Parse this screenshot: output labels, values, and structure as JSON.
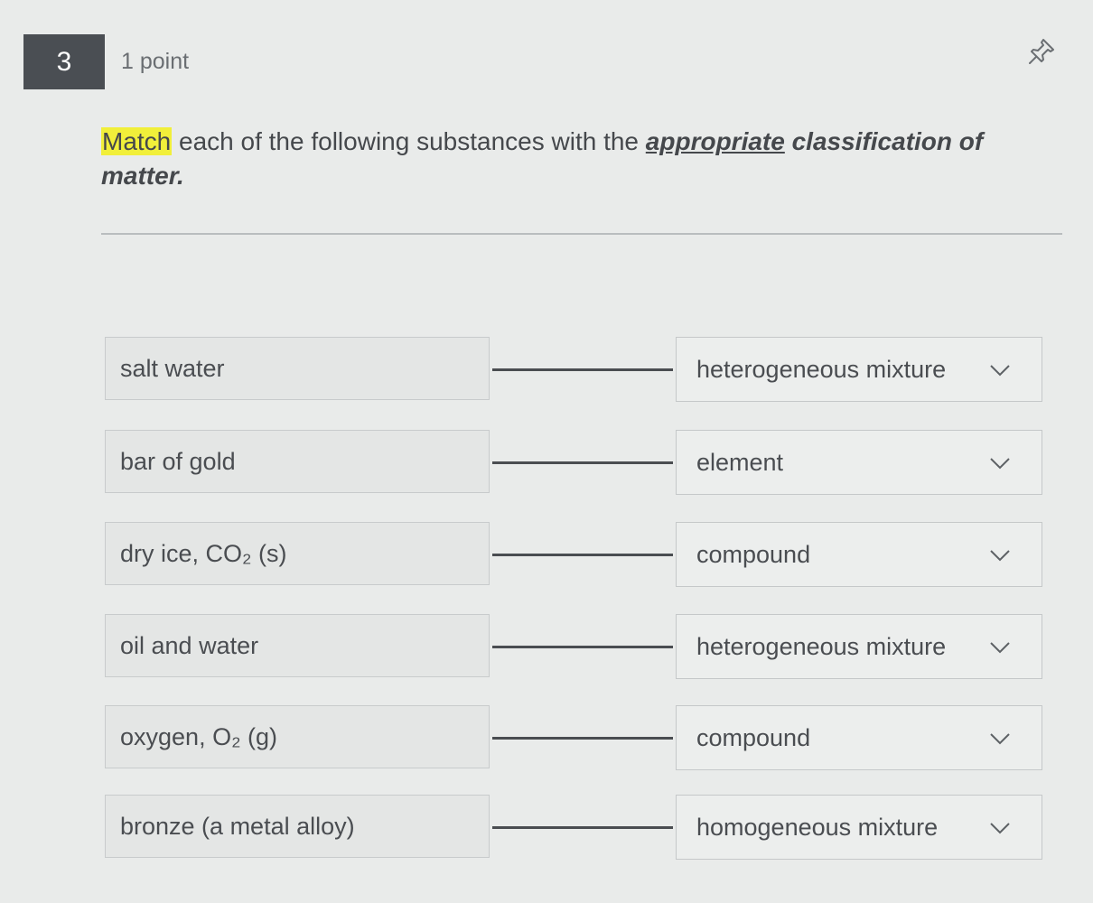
{
  "question": {
    "number": "3",
    "points": "1 point",
    "text_match": "Match",
    "text_mid": " each of the following substances with the ",
    "text_appropriate": "appropriate",
    "text_end": " classification of matter."
  },
  "pairs": [
    {
      "prompt": "salt water",
      "selected": "heterogeneous mixture"
    },
    {
      "prompt": "bar of gold",
      "selected": "element"
    },
    {
      "prompt": "dry ice, CO₂ (s)",
      "selected": "compound"
    },
    {
      "prompt": "oil and water",
      "selected": "heterogeneous mixture"
    },
    {
      "prompt": "oxygen, O₂ (g)",
      "selected": "compound"
    },
    {
      "prompt": "bronze (a metal alloy)",
      "selected": "homogeneous mixture"
    }
  ],
  "icons": {
    "pin": "pin-icon",
    "dropdown": "chevron-down-icon"
  }
}
